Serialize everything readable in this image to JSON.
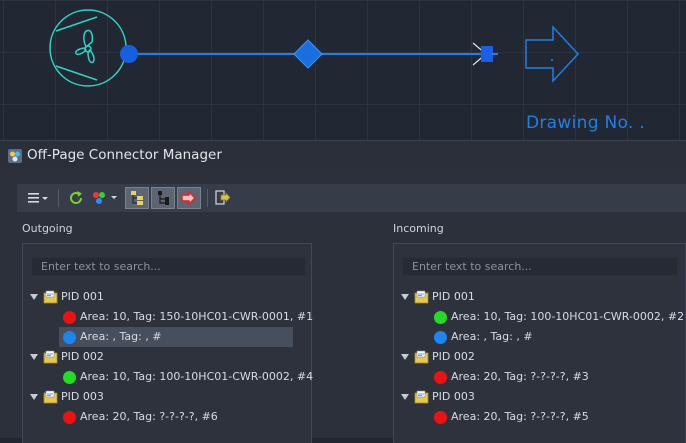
{
  "canvas": {
    "drawing_label": "Drawing No. .",
    "line_color": "#1f7fe8",
    "symbol_color": "#2fd3c4"
  },
  "window": {
    "title": "Off-Page Connector Manager"
  },
  "toolbar": {
    "buttons": [
      {
        "name": "menu",
        "icon": "hamburger-dropdown-icon"
      },
      {
        "name": "refresh",
        "icon": "refresh-icon"
      },
      {
        "name": "color-filter",
        "icon": "color-dots-dropdown-icon"
      },
      {
        "name": "view-tree-1",
        "icon": "tree-view-icon",
        "pressed": true
      },
      {
        "name": "view-tree-2",
        "icon": "tree-view-alt-icon",
        "pressed": true
      },
      {
        "name": "show-connectors",
        "icon": "red-arrow-icon",
        "pressed": true
      },
      {
        "name": "export",
        "icon": "export-arrow-icon"
      }
    ]
  },
  "outgoing": {
    "label": "Outgoing",
    "search_placeholder": "Enter text to search...",
    "groups": [
      {
        "pid": "PID 001",
        "items": [
          {
            "color": "red",
            "text": "Area: 10, Tag: 150-10HC01-CWR-0001, #1"
          },
          {
            "color": "blue",
            "text": "Area: , Tag: , #",
            "selected": true
          }
        ]
      },
      {
        "pid": "PID 002",
        "items": [
          {
            "color": "green",
            "text": "Area: 10, Tag: 100-10HC01-CWR-0002, #4"
          }
        ]
      },
      {
        "pid": "PID 003",
        "items": [
          {
            "color": "red",
            "text": "Area: 20, Tag: ?-?-?-?, #6"
          }
        ]
      }
    ]
  },
  "incoming": {
    "label": "Incoming",
    "search_placeholder": "Enter text to search...",
    "groups": [
      {
        "pid": "PID 001",
        "items": [
          {
            "color": "green",
            "text": "Area: 10, Tag: 100-10HC01-CWR-0002, #2"
          },
          {
            "color": "blue",
            "text": "Area: , Tag: , #"
          }
        ]
      },
      {
        "pid": "PID 002",
        "items": [
          {
            "color": "red",
            "text": "Area: 20, Tag: ?-?-?-?, #3"
          }
        ]
      },
      {
        "pid": "PID 003",
        "items": [
          {
            "color": "red",
            "text": "Area: 20, Tag: ?-?-?-?, #5"
          }
        ]
      }
    ]
  },
  "status_colors": {
    "red": "#ee1111",
    "green": "#22dd22",
    "blue": "#1a86f0"
  }
}
